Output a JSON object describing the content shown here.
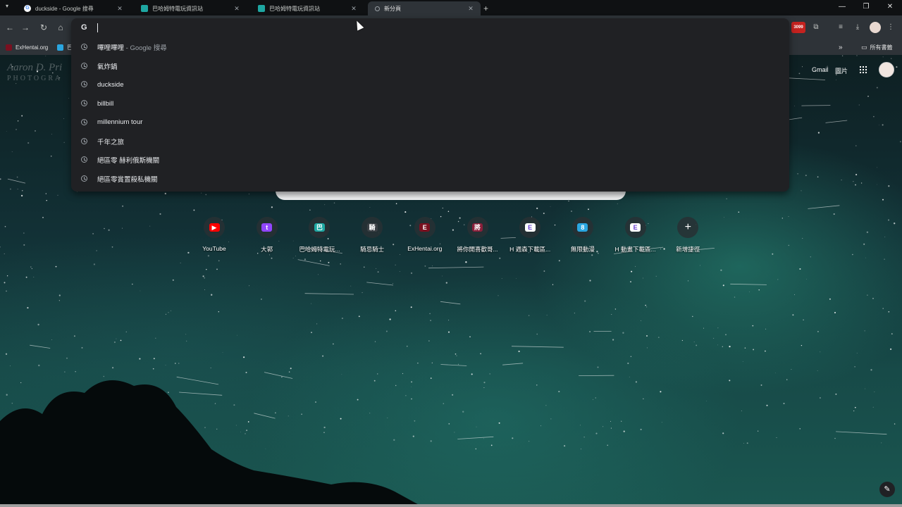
{
  "tabs": [
    {
      "title": "duckside - Google 搜尋",
      "favicon": "google-icon",
      "active": false
    },
    {
      "title": "巴哈姆特電玩資訊站",
      "favicon": "bahamut-icon",
      "active": false
    },
    {
      "title": "巴哈姆特電玩資訊站",
      "favicon": "bahamut-icon",
      "active": false
    },
    {
      "title": "新分頁",
      "favicon": "newtab-icon",
      "active": true
    }
  ],
  "toolbar": {
    "badge_text": "3099",
    "new_tab_symbol": "+"
  },
  "bookmarks": {
    "items": [
      {
        "label": "ExHentai.org"
      },
      {
        "label": "巴"
      }
    ],
    "all_bookmarks": "所有書籤"
  },
  "omnibox": {
    "value": "",
    "suggestions": [
      {
        "text": "嗶哩嗶哩",
        "suffix": " - Google 搜尋"
      },
      {
        "text": "氣炸鍋",
        "suffix": ""
      },
      {
        "text": "duckside",
        "suffix": ""
      },
      {
        "text": "billbill",
        "suffix": ""
      },
      {
        "text": "millennium tour",
        "suffix": ""
      },
      {
        "text": "千年之旅",
        "suffix": ""
      },
      {
        "text": "絕區零 赫利俄斯機關",
        "suffix": ""
      },
      {
        "text": "絕區零賞置殺私機關",
        "suffix": ""
      }
    ]
  },
  "ntp": {
    "gmail": "Gmail",
    "images": "圖片",
    "watermark_name": "Aaron D. Pri",
    "watermark_sub": "PHOTOGRA",
    "shortcuts": [
      {
        "label": "YouTube",
        "color": "#ff0000",
        "glyph": "▶"
      },
      {
        "label": "大郭",
        "color": "#9146ff",
        "glyph": "t"
      },
      {
        "label": "巴哈姆特電玩...",
        "color": "#1ea7a2",
        "glyph": "巴"
      },
      {
        "label": "騎忌騎士",
        "color": "#3a3f44",
        "glyph": "騎"
      },
      {
        "label": "ExHentai.org",
        "color": "#7a1020",
        "glyph": "E"
      },
      {
        "label": "將你開喜歡哥...",
        "color": "#8a1f3a",
        "glyph": "將"
      },
      {
        "label": "H 週森下載區...",
        "color": "#ffffff",
        "glyph": "E"
      },
      {
        "label": "無限動漫",
        "color": "#2aa6e0",
        "glyph": "8"
      },
      {
        "label": "H 動畫下載區...",
        "color": "#ffffff",
        "glyph": "E"
      },
      {
        "label": "新增捷徑",
        "color": "transparent",
        "glyph": "+"
      }
    ]
  }
}
